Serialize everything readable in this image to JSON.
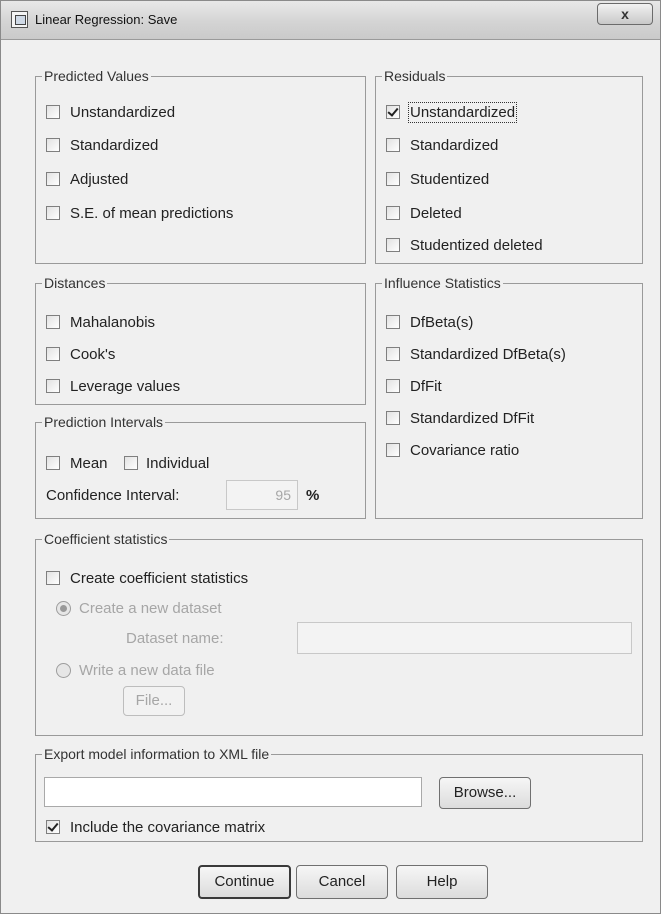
{
  "window": {
    "title": "Linear Regression: Save",
    "close": "x"
  },
  "predicted": {
    "legend": "Predicted Values",
    "items": [
      {
        "label": "Unstandardized",
        "checked": false
      },
      {
        "label": "Standardized",
        "checked": false
      },
      {
        "label": "Adjusted",
        "checked": false
      },
      {
        "label": "S.E. of mean predictions",
        "checked": false
      }
    ]
  },
  "residuals": {
    "legend": "Residuals",
    "items": [
      {
        "label": "Unstandardized",
        "checked": true
      },
      {
        "label": "Standardized",
        "checked": false
      },
      {
        "label": "Studentized",
        "checked": false
      },
      {
        "label": "Deleted",
        "checked": false
      },
      {
        "label": "Studentized deleted",
        "checked": false
      }
    ]
  },
  "distances": {
    "legend": "Distances",
    "items": [
      {
        "label": "Mahalanobis",
        "checked": false
      },
      {
        "label": "Cook's",
        "checked": false
      },
      {
        "label": "Leverage values",
        "checked": false
      }
    ]
  },
  "influence": {
    "legend": "Influence Statistics",
    "items": [
      {
        "label": "DfBeta(s)",
        "checked": false
      },
      {
        "label": "Standardized DfBeta(s)",
        "checked": false
      },
      {
        "label": "DfFit",
        "checked": false
      },
      {
        "label": "Standardized DfFit",
        "checked": false
      },
      {
        "label": "Covariance ratio",
        "checked": false
      }
    ]
  },
  "prediction_intervals": {
    "legend": "Prediction Intervals",
    "mean_label": "Mean",
    "individual_label": "Individual",
    "confidence_label": "Confidence Interval:",
    "confidence_value": "95",
    "percent": "%"
  },
  "coefficient": {
    "legend": "Coefficient statistics",
    "create_label": "Create coefficient statistics",
    "new_dataset_label": "Create a new dataset",
    "dataset_name_label": "Dataset name:",
    "write_file_label": "Write a new data file",
    "file_button": "File..."
  },
  "export": {
    "legend": "Export model information to XML file",
    "browse_button": "Browse...",
    "include_label": "Include the covariance matrix",
    "include_checked": true
  },
  "buttons": {
    "continue": "Continue",
    "cancel": "Cancel",
    "help": "Help"
  }
}
